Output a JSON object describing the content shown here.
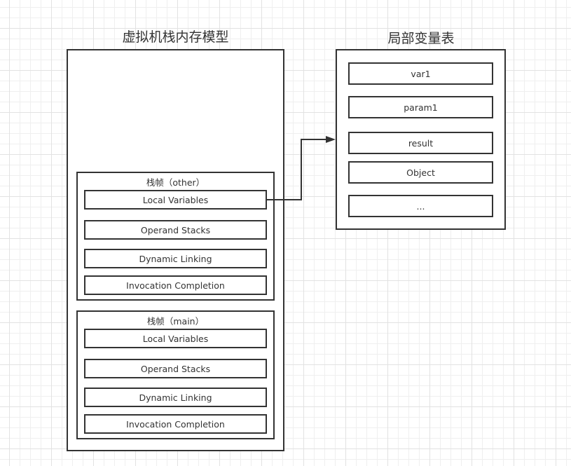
{
  "stack_model": {
    "title": "虚拟机栈内存模型",
    "frames": [
      {
        "label": "栈帧（other）",
        "rows": [
          "Local Variables",
          "Operand Stacks",
          "Dynamic Linking",
          "Invocation Completion"
        ]
      },
      {
        "label": "栈帧（main）",
        "rows": [
          "Local Variables",
          "Operand Stacks",
          "Dynamic Linking",
          "Invocation Completion"
        ]
      }
    ]
  },
  "local_variable_table": {
    "title": "局部变量表",
    "entries": [
      "var1",
      "param1",
      "result",
      "Object",
      "..."
    ]
  },
  "connector": {
    "from": "栈帧（other）.Local Variables",
    "to": "局部变量表",
    "arrow": "arrow-right-icon"
  },
  "colors": {
    "stroke": "#333333",
    "text": "#333333",
    "background": "#ffffff",
    "grid_minor": "#efefef",
    "grid_major": "#e2e2e2"
  }
}
